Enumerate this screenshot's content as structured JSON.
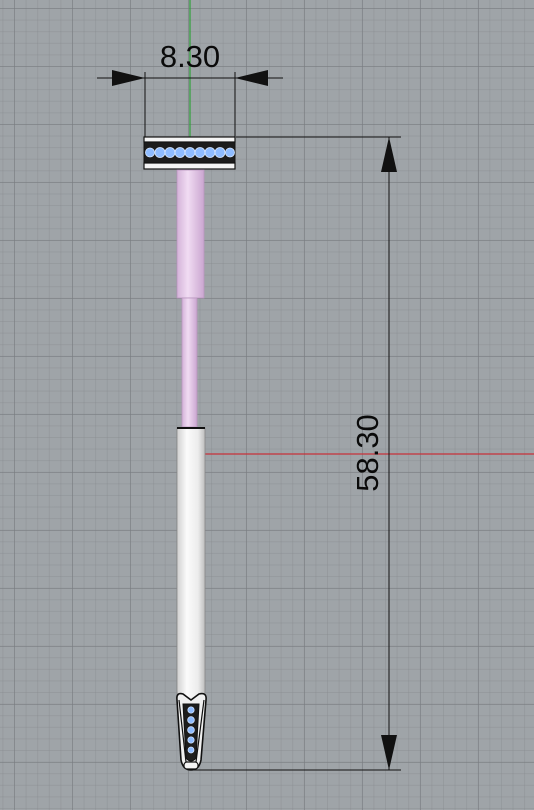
{
  "dimensions": {
    "width_label": "8.30",
    "height_label": "58.30"
  },
  "colors": {
    "background": "#9fa4a8",
    "grid_line": "#7e8286",
    "axis_y": "#2fa03a",
    "axis_x": "#c8323a",
    "dimension_line": "#111111",
    "gem": "#8fbcff",
    "upper_shaft": "#e6c8ec",
    "lower_shaft": "#f2f2f2"
  },
  "viewport": {
    "view": "front",
    "grid": true
  }
}
